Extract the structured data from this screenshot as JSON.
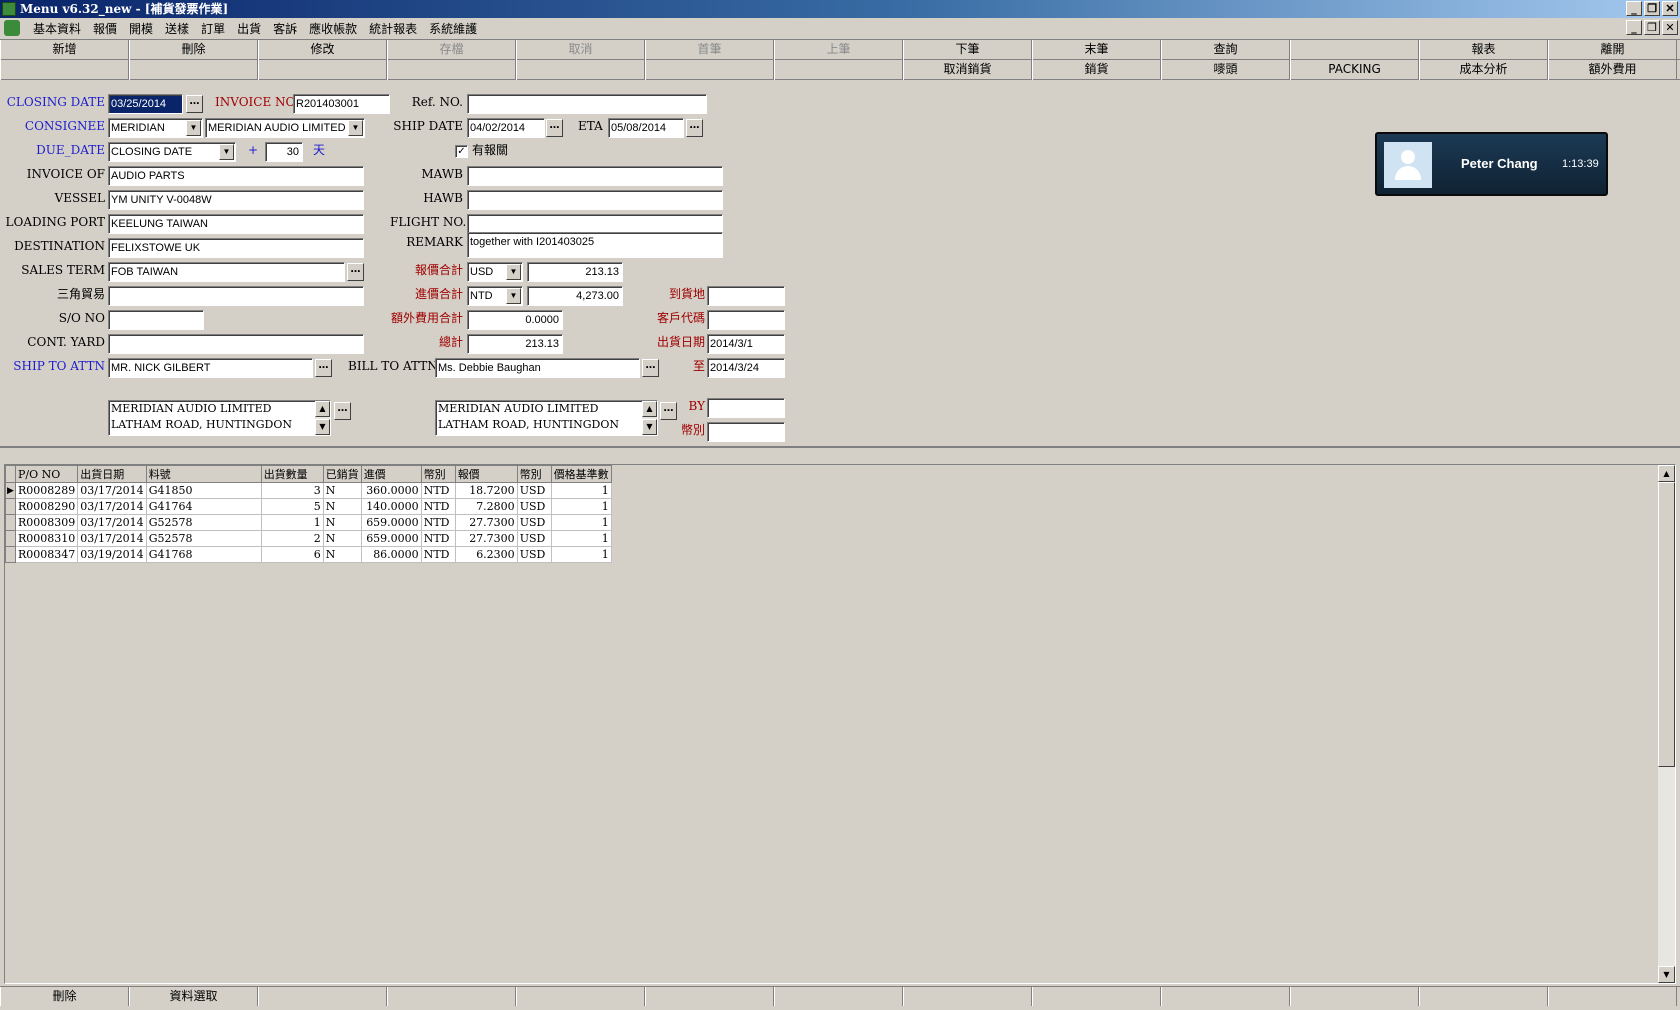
{
  "window": {
    "title": "Menu v6.32_new - [補貨發票作業]",
    "min": "_",
    "max": "❐",
    "close": "✕"
  },
  "menu": {
    "items": [
      "基本資料",
      "報價",
      "開模",
      "送樣",
      "訂單",
      "出貨",
      "客訴",
      "應收帳款",
      "統計報表",
      "系統維護"
    ]
  },
  "toolbar": {
    "row1": [
      "新增",
      "刪除",
      "修改",
      "存檔",
      "取消",
      "首筆",
      "上筆",
      "下筆",
      "末筆",
      "查詢",
      "",
      "報表",
      "離開"
    ],
    "row1_disabled": [
      false,
      false,
      false,
      true,
      true,
      true,
      true,
      false,
      false,
      false,
      false,
      false,
      false
    ],
    "row2": [
      "",
      "",
      "",
      "",
      "",
      "",
      "",
      "取消銷貨",
      "銷貨",
      "嘜頭",
      "PACKING",
      "成本分析",
      "額外費用"
    ]
  },
  "labels": {
    "closing_date": "CLOSING DATE",
    "invoice_no": "INVOICE NO",
    "ref_no": "Ref. NO.",
    "consignee": "CONSIGNEE",
    "ship_date": "SHIP DATE",
    "eta": "ETA",
    "due_date": "DUE_DATE",
    "plus": "+",
    "days": "天",
    "has_customs": "有報關",
    "invoice_of": "INVOICE OF",
    "mawb": "MAWB",
    "vessel": "VESSEL",
    "hawb": "HAWB",
    "loading_port": "LOADING PORT",
    "flight_no": "FLIGHT NO.",
    "destination": "DESTINATION",
    "remark": "REMARK",
    "sales_term": "SALES TERM",
    "quote_total": "報價合計",
    "triangle": "三角貿易",
    "purchase_total": "進價合計",
    "arrival": "到貨地",
    "so_no": "S/O NO",
    "extra_total": "額外費用合計",
    "customer_code": "客戶代碼",
    "cont_yard": "CONT. YARD",
    "grand_total": "總計",
    "ship_period": "出貨日期",
    "ship_to_attn": "SHIP TO  ATTN",
    "bill_to_attn": "BILL TO   ATTN",
    "to": "至",
    "by": "BY",
    "currency": "幣別"
  },
  "values": {
    "closing_date": "03/25/2014",
    "invoice_no": "R201403001",
    "ref_no": "",
    "consignee_code": "MERIDIAN",
    "consignee_name": "MERIDIAN AUDIO LIMITED",
    "ship_date": "04/02/2014",
    "eta": "05/08/2014",
    "due_basis": "CLOSING DATE",
    "due_days": "30",
    "invoice_of": "AUDIO PARTS",
    "mawb": "",
    "vessel": "YM UNITY V-0048W",
    "hawb": "",
    "loading_port": "KEELUNG TAIWAN",
    "flight_no": "",
    "destination": "FELIXSTOWE UK",
    "remark": "together with I201403025",
    "sales_term": "FOB TAIWAN",
    "quote_currency": "USD",
    "quote_total": "213.13",
    "triangle": "",
    "purchase_currency": "NTD",
    "purchase_total": "4,273.00",
    "arrival": "",
    "so_no": "",
    "extra_total": "0.0000",
    "customer_code": "",
    "cont_yard": "",
    "grand_total": "213.13",
    "ship_from": "2014/3/1",
    "ship_to": "2014/3/24",
    "ship_to_attn": "MR. NICK GILBERT",
    "ship_to_addr1": "MERIDIAN AUDIO LIMITED",
    "ship_to_addr2": "LATHAM ROAD, HUNTINGDON",
    "bill_to_attn": "Ms. Debbie Baughan",
    "bill_to_addr1": "MERIDIAN AUDIO LIMITED",
    "bill_to_addr2": "LATHAM ROAD, HUNTINGDON",
    "by": "",
    "currency": ""
  },
  "notification": {
    "name": "Peter Chang",
    "time": "1:13:39"
  },
  "grid": {
    "columns": [
      "P/O NO",
      "出貨日期",
      "料號",
      "出貨數量",
      "已銷貨",
      "進價",
      "幣別",
      "報價",
      "幣別",
      "價格基準數"
    ],
    "rows": [
      [
        "R0008289",
        "03/17/2014",
        "G41850",
        "3",
        "N",
        "360.0000",
        "NTD",
        "18.7200",
        "USD",
        "1"
      ],
      [
        "R0008290",
        "03/17/2014",
        "G41764",
        "5",
        "N",
        "140.0000",
        "NTD",
        "7.2800",
        "USD",
        "1"
      ],
      [
        "R0008309",
        "03/17/2014",
        "G52578",
        "1",
        "N",
        "659.0000",
        "NTD",
        "27.7300",
        "USD",
        "1"
      ],
      [
        "R0008310",
        "03/17/2014",
        "G52578",
        "2",
        "N",
        "659.0000",
        "NTD",
        "27.7300",
        "USD",
        "1"
      ],
      [
        "R0008347",
        "03/19/2014",
        "G41768",
        "6",
        "N",
        "86.0000",
        "NTD",
        "6.2300",
        "USD",
        "1"
      ]
    ]
  },
  "bottombar": {
    "buttons": [
      "刪除",
      "資料選取",
      "",
      "",
      "",
      "",
      "",
      "",
      "",
      "",
      "",
      "",
      ""
    ]
  }
}
